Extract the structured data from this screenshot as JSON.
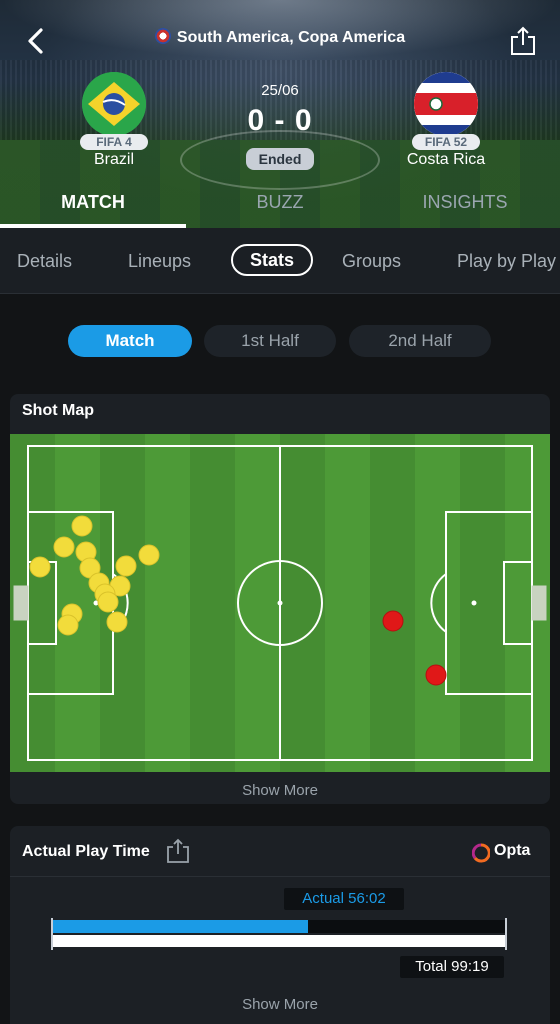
{
  "header": {
    "competition": "South America, Copa America",
    "date": "25/06",
    "score": "0 - 0",
    "status": "Ended",
    "home": {
      "name": "Brazil",
      "rank": "FIFA 4"
    },
    "away": {
      "name": "Costa Rica",
      "rank": "FIFA 52"
    }
  },
  "main_tabs": [
    "MATCH",
    "BUZZ",
    "INSIGHTS"
  ],
  "sub_tabs": [
    "Details",
    "Lineups",
    "Stats",
    "Groups",
    "Play by Play"
  ],
  "half_selector": [
    "Match",
    "1st Half",
    "2nd Half"
  ],
  "shot_map": {
    "title": "Shot Map",
    "show_more": "Show More",
    "colors": {
      "home": "#f2dc3b",
      "away": "#e01818",
      "pitch_a": "#4d9a37",
      "pitch_b": "#458d32"
    }
  },
  "play_time": {
    "title": "Actual Play Time",
    "actual_label": "Actual 56:02",
    "total_label": "Total 99:19",
    "actual_fraction": 0.564,
    "provider": "Opta",
    "show_more": "Show More"
  },
  "colors": {
    "accent": "#1b9be6",
    "background": "#121416",
    "card": "#1c2025"
  }
}
